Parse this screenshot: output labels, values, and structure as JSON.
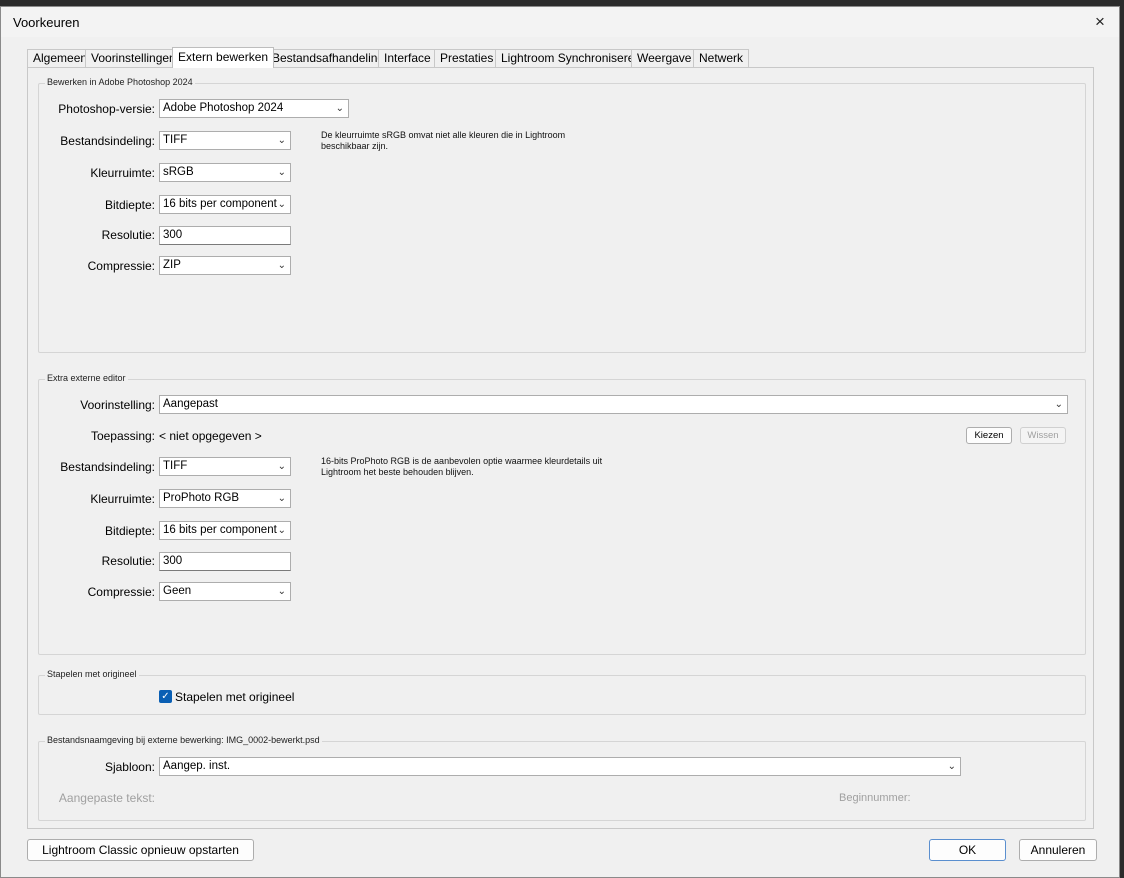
{
  "window": {
    "title": "Voorkeuren",
    "close_icon": "×"
  },
  "tabs": [
    {
      "label": "Algemeen"
    },
    {
      "label": "Voorinstellingen"
    },
    {
      "label": "Extern bewerken"
    },
    {
      "label": "Bestandsafhandeling"
    },
    {
      "label": "Interface"
    },
    {
      "label": "Prestaties"
    },
    {
      "label": "Lightroom Synchroniseren"
    },
    {
      "label": "Weergave"
    },
    {
      "label": "Netwerk"
    }
  ],
  "active_tab": "Extern bewerken",
  "photoshop": {
    "title": "Bewerken in Adobe Photoshop 2024",
    "version_label": "Photoshop-versie:",
    "version_value": "Adobe Photoshop 2024",
    "format_label": "Bestandsindeling:",
    "format_value": "TIFF",
    "note": "De kleurruimte sRGB omvat niet alle kleuren die in Lightroom beschikbaar zijn.",
    "colorspace_label": "Kleurruimte:",
    "colorspace_value": "sRGB",
    "bitdepth_label": "Bitdiepte:",
    "bitdepth_value": "16 bits per component",
    "resolution_label": "Resolutie:",
    "resolution_value": "300",
    "compression_label": "Compressie:",
    "compression_value": "ZIP"
  },
  "extra_editor": {
    "title": "Extra externe editor",
    "preset_label": "Voorinstelling:",
    "preset_value": "Aangepast",
    "app_label": "Toepassing:",
    "app_value": "< niet opgegeven >",
    "choose_button": "Kiezen",
    "clear_button": "Wissen",
    "format_label": "Bestandsindeling:",
    "format_value": "TIFF",
    "note": "16-bits ProPhoto RGB is de aanbevolen optie waarmee kleurdetails uit Lightroom het beste behouden blijven.",
    "colorspace_label": "Kleurruimte:",
    "colorspace_value": "ProPhoto RGB",
    "bitdepth_label": "Bitdiepte:",
    "bitdepth_value": "16 bits per component",
    "resolution_label": "Resolutie:",
    "resolution_value": "300",
    "compression_label": "Compressie:",
    "compression_value": "Geen"
  },
  "stack": {
    "title": "Stapelen met origineel",
    "checkbox_label": "Stapelen met origineel",
    "checked": true
  },
  "naming": {
    "title": "Bestandsnaamgeving bij externe bewerking: IMG_0002-bewerkt.psd",
    "template_label": "Sjabloon:",
    "template_value": "Aangep. inst.",
    "custom_text_label": "Aangepaste tekst:",
    "start_number_label": "Beginnummer:"
  },
  "footer": {
    "restart_button": "Lightroom Classic opnieuw opstarten",
    "ok_button": "OK",
    "cancel_button": "Annuleren"
  },
  "icons": {
    "dropdown": "chevron-down-icon",
    "check": "checkmark-icon",
    "close": "close-icon"
  }
}
